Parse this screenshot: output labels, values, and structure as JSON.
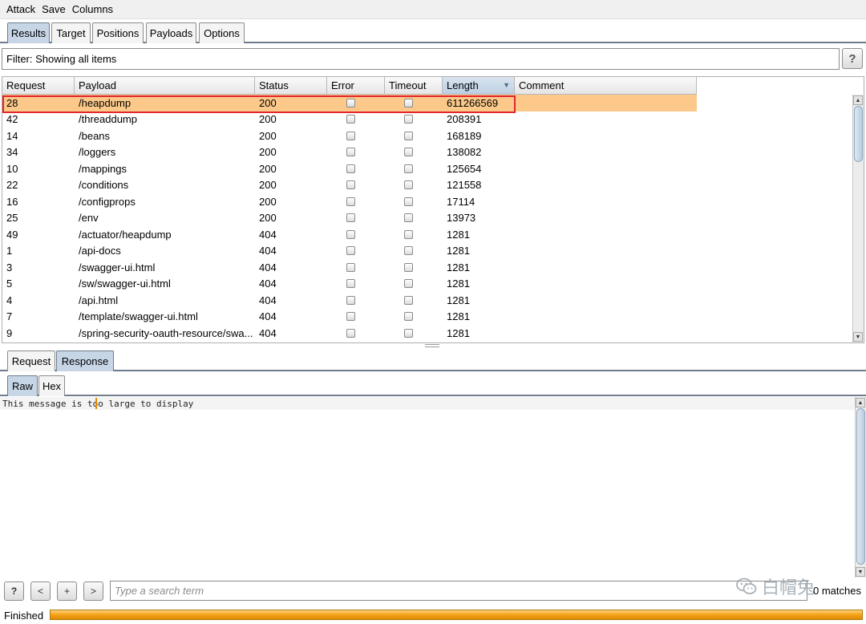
{
  "menu": [
    "Attack",
    "Save",
    "Columns"
  ],
  "top_tabs": [
    {
      "label": "Results",
      "active": true
    },
    {
      "label": "Target",
      "active": false
    },
    {
      "label": "Positions",
      "active": false
    },
    {
      "label": "Payloads",
      "active": false
    },
    {
      "label": "Options",
      "active": false
    }
  ],
  "filter": {
    "text": "Filter: Showing all items",
    "help": "?"
  },
  "table": {
    "columns": [
      "Request",
      "Payload",
      "Status",
      "Error",
      "Timeout",
      "Length",
      "Comment"
    ],
    "sorted_column": "Length",
    "sort_direction_icon": "▼",
    "rows": [
      {
        "request": "28",
        "payload": "/heapdump",
        "status": "200",
        "length": "611266569",
        "selected": true
      },
      {
        "request": "42",
        "payload": "/threaddump",
        "status": "200",
        "length": "208391"
      },
      {
        "request": "14",
        "payload": "/beans",
        "status": "200",
        "length": "168189"
      },
      {
        "request": "34",
        "payload": "/loggers",
        "status": "200",
        "length": "138082"
      },
      {
        "request": "10",
        "payload": "/mappings",
        "status": "200",
        "length": "125654"
      },
      {
        "request": "22",
        "payload": "/conditions",
        "status": "200",
        "length": "121558"
      },
      {
        "request": "16",
        "payload": "/configprops",
        "status": "200",
        "length": "17114"
      },
      {
        "request": "25",
        "payload": "/env",
        "status": "200",
        "length": "13973"
      },
      {
        "request": "49",
        "payload": "/actuator/heapdump",
        "status": "404",
        "length": "1281"
      },
      {
        "request": "1",
        "payload": "/api-docs",
        "status": "404",
        "length": "1281"
      },
      {
        "request": "3",
        "payload": "/swagger-ui.html",
        "status": "404",
        "length": "1281"
      },
      {
        "request": "5",
        "payload": "/sw/swagger-ui.html",
        "status": "404",
        "length": "1281"
      },
      {
        "request": "4",
        "payload": "/api.html",
        "status": "404",
        "length": "1281"
      },
      {
        "request": "7",
        "payload": "/template/swagger-ui.html",
        "status": "404",
        "length": "1281"
      },
      {
        "request": "9",
        "payload": "/spring-security-oauth-resource/swa...",
        "status": "404",
        "length": "1281"
      }
    ]
  },
  "rr_tabs": [
    {
      "label": "Request",
      "active": false
    },
    {
      "label": "Response",
      "active": true
    }
  ],
  "view_tabs": [
    {
      "label": "Raw",
      "active": true
    },
    {
      "label": "Hex",
      "active": false
    }
  ],
  "message": "This message is too large to display",
  "search": {
    "help": "?",
    "prev": "<",
    "add": "+",
    "next": ">",
    "placeholder": "Type a search term",
    "matches": "0 matches"
  },
  "watermark": "白帽兔",
  "status": {
    "label": "Finished",
    "progress": 1.0
  },
  "colors": {
    "selected_row": "#fcc98a",
    "highlight_box": "#e0262b",
    "progress": "#f3a21a",
    "active_tab": "#c7d6e6"
  }
}
